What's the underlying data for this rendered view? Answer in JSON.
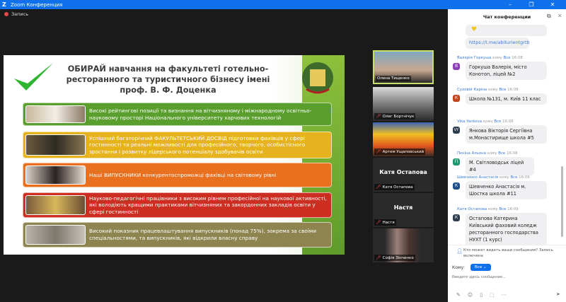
{
  "window": {
    "title": "Zoom Конференция",
    "minimize": "–",
    "restore": "❐",
    "close": "✕"
  },
  "toolbar": {
    "record_label": "Запись"
  },
  "slide": {
    "title": "ОБИРАЙ навчання на факультеті готельно-ресторанного та туристичного бізнесу імені проф. В. Ф. Доценка",
    "rows": [
      {
        "text": "Високі рейтингові позиції та визнання на вітчизняному і міжнародному освітньо-науковому просторі Національного університету харчових технологій",
        "color": "#5a9e2e"
      },
      {
        "text": "Успішний багаторічний ФАКУЛЬТЕТСЬКИЙ ДОСВІД підготовки фахівців у сфері гостинності та реальні можливості для професійного, творчого, особистісного зростання і розвитку лідерського потенціалу здобувачів освіти",
        "color": "#e6b31e"
      },
      {
        "text": "Наші ВИПУСКНИКИ конкурентоспроможці фахівці на світовому рівні",
        "color": "#e8701f"
      },
      {
        "text": "Науково-педагогічні працівники з високим рівнем професійної на наукової активності, які володіють кращими практиками вітчизняних та закордонних закладів освіти у сфері гостинності",
        "color": "#cc2f22"
      },
      {
        "text": "Високий показник працевлаштування випускників (понад 75%), зокрема за своїми спеціальностями, та випускників, які відкрили власну справу",
        "color": "#8e8450"
      }
    ]
  },
  "participants": [
    {
      "name": "Олена Тищенко",
      "video": true,
      "active": true
    },
    {
      "name": "Олег Бортнічук",
      "video": true
    },
    {
      "name": "Артем Ущаповський",
      "video": true
    },
    {
      "name": "Катя Остапова",
      "video": false
    },
    {
      "name": "Настя",
      "video": false
    },
    {
      "name": "Софія Зінченко",
      "video": true
    }
  ],
  "chat": {
    "title": "Чат конференции",
    "link": "https://t.me/abiturientgrtb",
    "to_word": "кому",
    "messages": [
      {
        "sender": "Валерія Горкуша",
        "to": "Все",
        "time": "16:08",
        "initial": "В",
        "color": "#8a3fb5",
        "text": "Горкуша Валерія, місто Конотоп, ліцей №2"
      },
      {
        "sender": "Суховій Каріна",
        "to": "Все",
        "time": "16:08",
        "initial": "К",
        "color": "#c2441c",
        "text": "Школа №131, м. Київ 11 клас"
      },
      {
        "sender": "Vika Yankova",
        "to": "Все",
        "time": "16:08",
        "initial": "VY",
        "color": "#2f3e4e",
        "text": "Янкова Вікторія Сергіївна м.Монастирище школа #5"
      },
      {
        "sender": "Пєніна Альона",
        "to": "Все",
        "time": "16:08",
        "initial": "П",
        "color": "#1f9a6e",
        "text": "М. Світловодськ ліцей #4"
      },
      {
        "sender": "Шевченко Анастасія",
        "to": "Все",
        "time": "16:09",
        "initial": "К",
        "color": "#1e4f8a",
        "text": "Шевченко Анастасія м. Шостка школа #11"
      },
      {
        "sender": "Катя Остапова",
        "to": "Все",
        "time": "16:09",
        "initial": "К",
        "color": "#2f3e4e",
        "text": "Остапова Катерина Київський фаховий коледж ресторанного господарства НУХТ (1 курс)"
      }
    ],
    "notice": "Кто может видеть ваши сообщения? Запись включена",
    "to_label": "Кому:",
    "to_value": "Все",
    "placeholder": "Введите здесь сообщение..."
  }
}
